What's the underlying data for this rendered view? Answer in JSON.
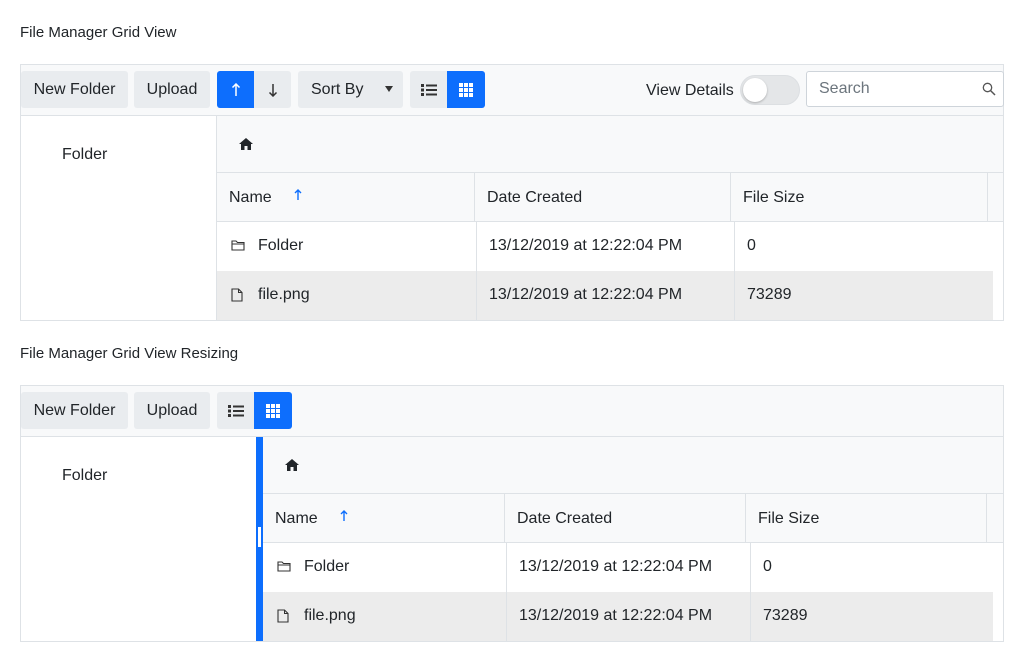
{
  "sections": [
    {
      "title": "File Manager Grid View",
      "toolbar": {
        "new_folder": "New Folder",
        "upload": "Upload",
        "sort_asc_icon": "arrow-up-icon",
        "sort_desc_icon": "arrow-down-icon",
        "sort_by": "Sort By",
        "list_view_icon": "list-view-icon",
        "grid_view_icon": "grid-view-icon",
        "view_details": "View Details",
        "view_details_on": false,
        "search_placeholder": "Search"
      },
      "tree": {
        "items": [
          "Folder"
        ]
      },
      "breadcrumb": {
        "icon": "home-icon"
      },
      "grid": {
        "columns": [
          "Name",
          "Date Created",
          "File Size"
        ],
        "sort_column": "Name",
        "sort_direction": "ascending",
        "rows": [
          {
            "icon": "folder-icon",
            "name": "Folder",
            "date": "13/12/2019 at 12:22:04 PM",
            "size": "0"
          },
          {
            "icon": "file-icon",
            "name": "file.png",
            "date": "13/12/2019 at 12:22:04 PM",
            "size": "73289"
          }
        ]
      }
    },
    {
      "title": "File Manager Grid View Resizing",
      "toolbar": {
        "new_folder": "New Folder",
        "upload": "Upload",
        "list_view_icon": "list-view-icon",
        "grid_view_icon": "grid-view-icon"
      },
      "tree": {
        "items": [
          "Folder"
        ]
      },
      "breadcrumb": {
        "icon": "home-icon"
      },
      "grid": {
        "columns": [
          "Name",
          "Date Created",
          "File Size"
        ],
        "sort_column": "Name",
        "sort_direction": "ascending",
        "rows": [
          {
            "icon": "folder-icon",
            "name": "Folder",
            "date": "13/12/2019 at 12:22:04 PM",
            "size": "0"
          },
          {
            "icon": "file-icon",
            "name": "file.png",
            "date": "13/12/2019 at 12:22:04 PM",
            "size": "73289"
          }
        ]
      }
    }
  ],
  "colors": {
    "accent": "#0d6efd",
    "toolbar_bg": "#f8f9fa",
    "button_bg": "#e9ecef",
    "alt_row_bg": "#ececec",
    "border": "#dee2e6"
  }
}
